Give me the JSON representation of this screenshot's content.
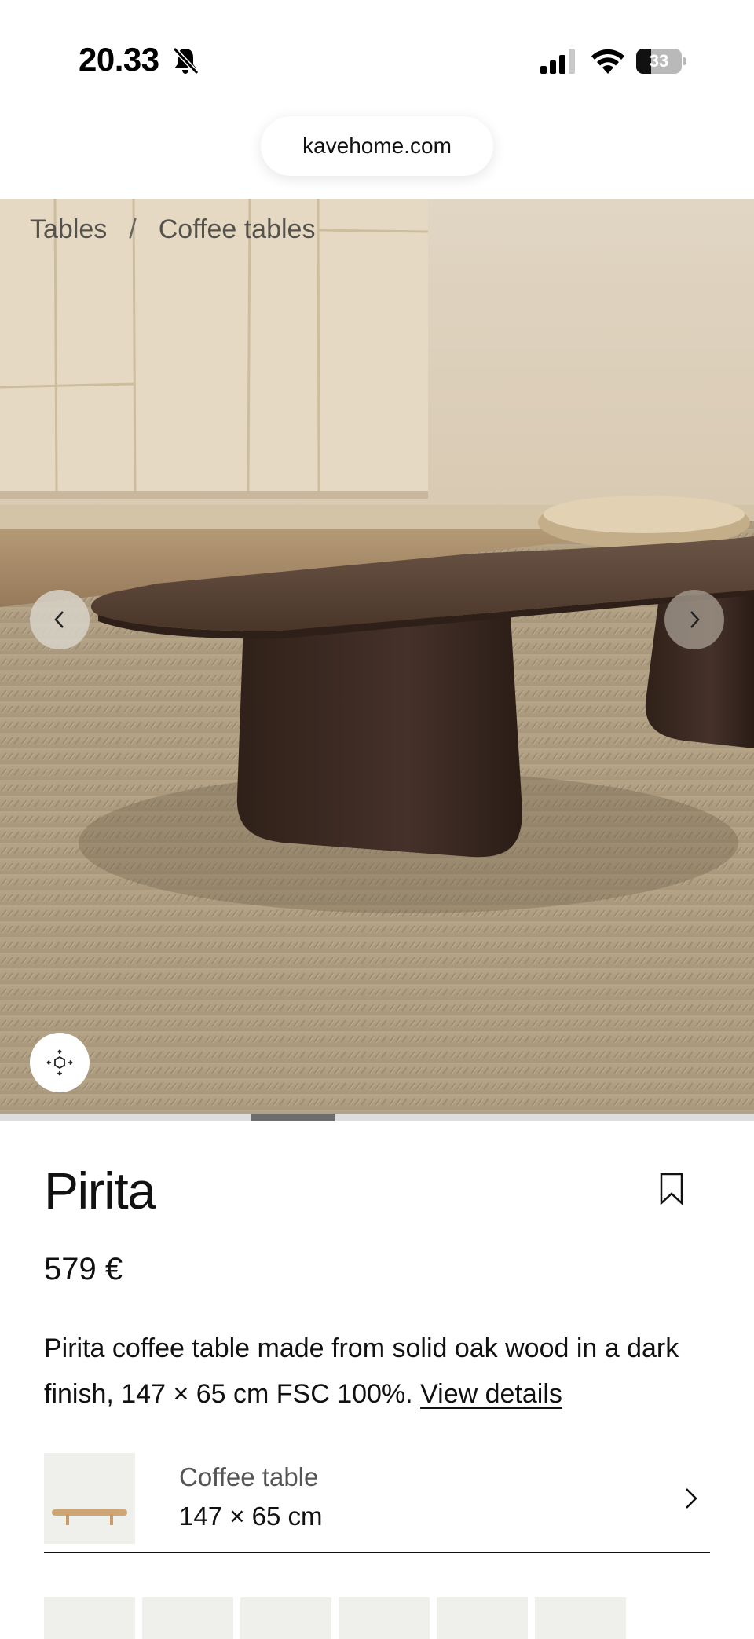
{
  "status_bar": {
    "time": "20.33",
    "battery_percent": "33",
    "battery_level": 0.33
  },
  "browser": {
    "url": "kavehome.com"
  },
  "breadcrumb": {
    "items": [
      "Tables",
      "Coffee tables"
    ],
    "separator": "/"
  },
  "gallery": {
    "icons": {
      "prev": "chevron-left-icon",
      "next": "chevron-right-icon",
      "view3d": "view-3d-icon"
    },
    "progress_fraction": 0.11
  },
  "product": {
    "title": "Pirita",
    "price": "579 €",
    "description": "Pirita coffee table made from solid oak wood in a dark finish, 147 × 65 cm FSC 100%. ",
    "details_link": "View details"
  },
  "variant": {
    "type": "Coffee table",
    "size": "147 × 65 cm"
  },
  "colors": {
    "accent": "#111111",
    "wood_dark": "#3b2a20",
    "rug": "#b8a88d",
    "wall": "#ddd0bb"
  }
}
